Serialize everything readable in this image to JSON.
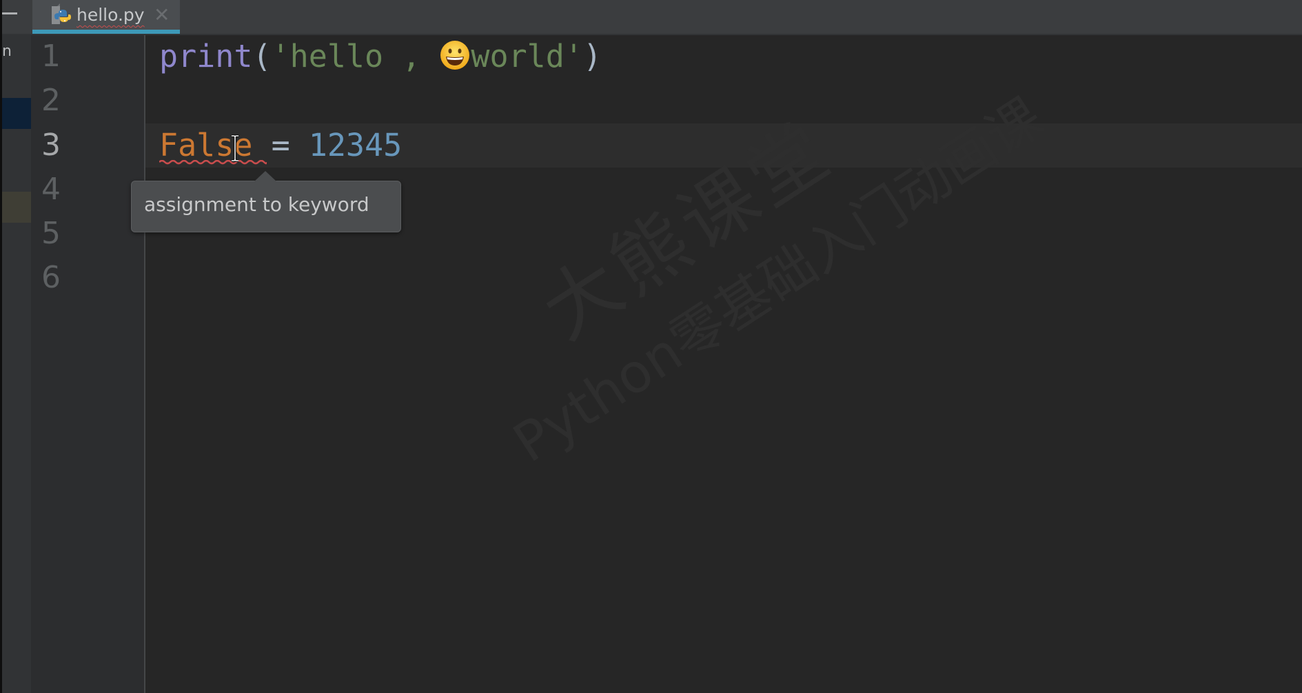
{
  "tabs": [
    {
      "label": "hello.py",
      "icon": "python-file-icon",
      "active": true,
      "close_icon": "close-icon",
      "close_glyph": "✕"
    }
  ],
  "sidebar": {
    "partial_label": "n"
  },
  "gutter": {
    "line_numbers": [
      "1",
      "2",
      "3",
      "4",
      "5",
      "6"
    ],
    "active_line": 3
  },
  "code": {
    "line1": {
      "fn": "print",
      "open": "(",
      "str_a": "'hello , ",
      "emoji": "grinning-face",
      "str_b": "world'",
      "close": ")"
    },
    "line2": "",
    "line3": {
      "keyword": "False",
      "op": "=",
      "number": "12345"
    },
    "line4": "",
    "line5": "",
    "line6": ""
  },
  "inspection": {
    "message": "assignment to keyword",
    "severity": "error"
  },
  "watermark": {
    "line1": "大熊课堂",
    "line2": "Python零基础入门动画课"
  },
  "colors": {
    "editor_bg": "#262626",
    "gutter_bg": "#2c2d2f",
    "tab_accent": "#3d99b8",
    "keyword": "#cc7832",
    "string": "#6a8759",
    "number": "#6897bb",
    "builtin": "#8f87cc",
    "error_underline": "#c84d4d"
  }
}
